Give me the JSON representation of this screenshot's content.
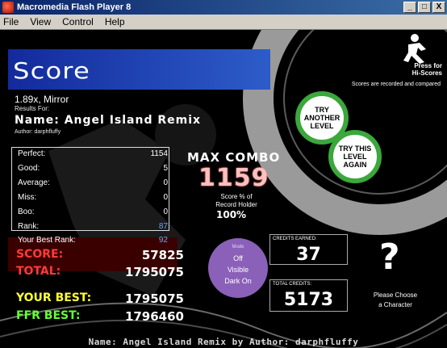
{
  "window": {
    "title": "Macromedia Flash Player 8",
    "controls": [
      "_",
      "□",
      "X"
    ]
  },
  "menu": [
    "File",
    "View",
    "Control",
    "Help"
  ],
  "header": {
    "title": "Score",
    "hiscore_link": [
      "Press for",
      "Hi-Scores"
    ],
    "note": "Scores are recorded and compared"
  },
  "song": {
    "rate_mods": "1.89x, Mirror",
    "results_for": "Results For:",
    "name": "Name: Angel Island Remix",
    "author": "Author: darphfluffy"
  },
  "buttons": {
    "try_another": [
      "TRY",
      "ANOTHER",
      "LEVEL"
    ],
    "try_again": [
      "TRY THIS",
      "LEVEL",
      "AGAIN"
    ]
  },
  "stats": [
    {
      "label": "Perfect:",
      "value": "1154"
    },
    {
      "label": "Good:",
      "value": "5"
    },
    {
      "label": "Average:",
      "value": "0"
    },
    {
      "label": "Miss:",
      "value": "0"
    },
    {
      "label": "Boo:",
      "value": "0"
    },
    {
      "label": "Rank:",
      "value": "87"
    },
    {
      "label": "Your Best Rank:",
      "value": "92"
    }
  ],
  "combo": {
    "label": "MAX COMBO",
    "value": "1159",
    "record_label": [
      "Score % of",
      "Record Holder"
    ],
    "record_value": "100%"
  },
  "scores": {
    "score_label": "SCORE:",
    "score_value": "57825",
    "total_label": "TOTAL:",
    "total_value": "1795075",
    "your_best_label": "YOUR BEST:",
    "your_best_value": "1795075",
    "ffr_best_label": "FFR BEST:",
    "ffr_best_value": "1796460"
  },
  "settings": {
    "small": "Mode",
    "option1": "Off",
    "option2": "Visible",
    "option3": "Dark On"
  },
  "credits": {
    "earned_label": "CREDITS EARNED:",
    "earned_value": "37",
    "total_label": "TOTAL CREDITS:",
    "total_value": "5173"
  },
  "character": {
    "symbol": "?",
    "prompt": [
      "Please Choose",
      "a Character"
    ]
  },
  "footer": "Name: Angel Island Remix by Author: darphfluffy",
  "colors": {
    "header_blue": "#2d5cc8",
    "button_ring": "#3aa83a",
    "score_label": "#ff3a3a",
    "your_best": "#ffff33",
    "ffr_best": "#66ff33",
    "combo": "#ffbfbf",
    "settings_purple": "#8a60b8"
  }
}
